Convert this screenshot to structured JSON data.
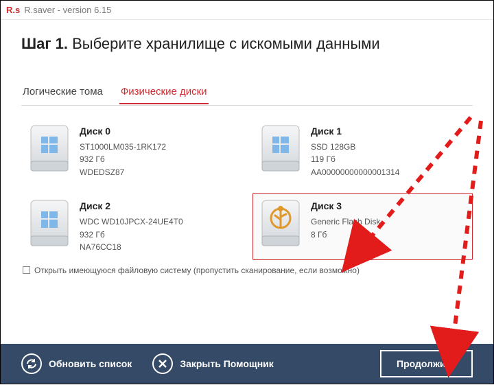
{
  "title": {
    "logo": "R.s",
    "appname": "R.saver",
    "version": "version 6.15"
  },
  "header": {
    "step_prefix": "Шаг 1.",
    "step_text": "Выберите хранилище с искомыми данными"
  },
  "tabs": {
    "logical": "Логические тома",
    "physical": "Физические диски"
  },
  "disks": [
    {
      "title": "Диск 0",
      "line1": "ST1000LM035-1RK172",
      "line2": "932 Гб",
      "line3": "WDEDSZ87",
      "selected": false,
      "icon": "windows"
    },
    {
      "title": "Диск 1",
      "line1": "SSD 128GB",
      "line2": "119 Гб",
      "line3": "AA00000000000001314",
      "selected": false,
      "icon": "windows"
    },
    {
      "title": "Диск 2",
      "line1": "WDC WD10JPCX-24UE4T0",
      "line2": "932 Гб",
      "line3": "NA76CC18",
      "selected": false,
      "icon": "windows"
    },
    {
      "title": "Диск 3",
      "line1": "Generic Flash Disk",
      "line2": "8 Гб",
      "line3": "",
      "selected": true,
      "icon": "usb"
    }
  ],
  "skip": {
    "label": "Открыть имеющуюся файловую систему (пропустить сканирование, если возможно)"
  },
  "footer": {
    "refresh": "Обновить список",
    "close": "Закрыть Помощник",
    "continue": "Продолжить"
  },
  "colors": {
    "accent": "#d02c31",
    "footer": "#344a66"
  }
}
